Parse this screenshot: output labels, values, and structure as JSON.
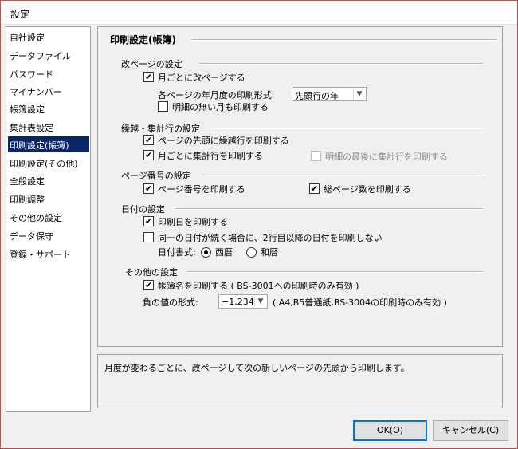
{
  "window": {
    "title": "設定"
  },
  "nav": {
    "items": [
      {
        "label": "自社設定"
      },
      {
        "label": "データファイル"
      },
      {
        "label": "パスワード"
      },
      {
        "label": "マイナンバー"
      },
      {
        "label": "帳簿設定"
      },
      {
        "label": "集計表設定"
      },
      {
        "label": "印刷設定(帳簿)",
        "selected": true
      },
      {
        "label": "印刷設定(その他)"
      },
      {
        "label": "全般設定"
      },
      {
        "label": "印刷調整"
      },
      {
        "label": "その他の設定"
      },
      {
        "label": "データ保守"
      },
      {
        "label": "登録・サポート"
      }
    ]
  },
  "panel": {
    "title": "印刷設定(帳簿)",
    "page_break": {
      "heading": "改ページの設定",
      "monthly_break": {
        "label": "月ごとに改ページする",
        "checked": true
      },
      "year_format_label": "各ページの年月度の印刷形式:",
      "year_format_value": "先頭行の年",
      "print_empty_month": {
        "label": "明細の無い月も印刷する",
        "checked": false
      }
    },
    "carryover": {
      "heading": "繰越・集計行の設定",
      "print_carry_row": {
        "label": "ページの先頭に繰越行を印刷する",
        "checked": true
      },
      "monthly_total": {
        "label": "月ごとに集計行を印刷する",
        "checked": true
      },
      "total_at_end": {
        "label": "明細の最後に集計行を印刷する",
        "checked": false,
        "disabled": true
      }
    },
    "page_number": {
      "heading": "ページ番号の設定",
      "print_page_no": {
        "label": "ページ番号を印刷する",
        "checked": true
      },
      "print_total_pages": {
        "label": "総ページ数を印刷する",
        "checked": true
      }
    },
    "date": {
      "heading": "日付の設定",
      "print_date": {
        "label": "印刷日を印刷する",
        "checked": true
      },
      "suppress_same_date": {
        "label": "同一の日付が続く場合に、2行目以降の日付を印刷しない",
        "checked": false
      },
      "format_label": "日付書式:",
      "seireki": {
        "label": "西暦",
        "selected": true
      },
      "wareki": {
        "label": "和暦",
        "selected": false
      }
    },
    "other": {
      "heading": "その他の設定",
      "print_book_name": {
        "label": "帳簿名を印刷する ( BS-3001への印刷時のみ有効 )",
        "checked": true
      },
      "negative_label": "負の値の形式:",
      "negative_value": "−1,234",
      "negative_note": "( A4,B5普通紙,BS-3004の印刷時のみ有効 )"
    }
  },
  "description": "月度が変わるごとに、改ページして次の新しいページの先頭から印刷します。",
  "buttons": {
    "ok": "OK(O)",
    "cancel": "キャンセル(C)"
  },
  "icons": {
    "check": "✔",
    "combo_arrow": "▼"
  }
}
